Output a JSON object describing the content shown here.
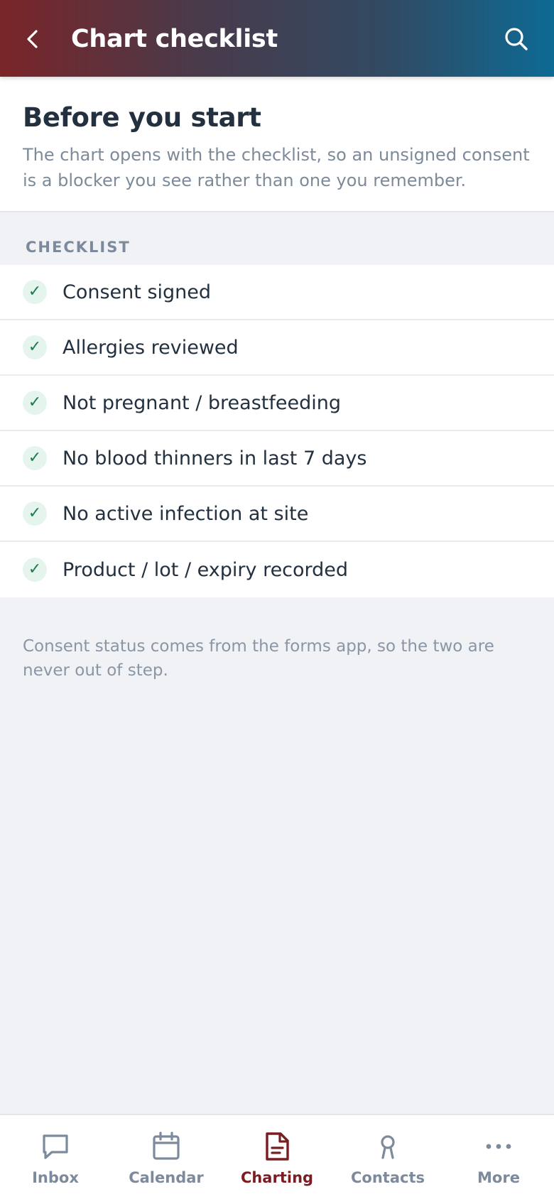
{
  "header": {
    "title": "Chart checklist",
    "back_icon": "chevron-left-icon",
    "search_icon": "search-icon"
  },
  "intro": {
    "heading": "Before you start",
    "description": "The chart opens with the checklist, so an unsigned consent is a blocker you see rather than one you remember."
  },
  "checklist": {
    "section_label": "CHECKLIST",
    "items": [
      {
        "label": "Consent signed",
        "checked": true
      },
      {
        "label": "Allergies reviewed",
        "checked": true
      },
      {
        "label": "Not pregnant / breastfeeding",
        "checked": true
      },
      {
        "label": "No blood thinners in last 7 days",
        "checked": true
      },
      {
        "label": "No active infection at site",
        "checked": true
      },
      {
        "label": "Product / lot / expiry recorded",
        "checked": true
      }
    ],
    "check_glyph": "✓"
  },
  "footnote": "Consent status comes from the forms app, so the two are never out of step.",
  "tab_bar": {
    "tabs": [
      {
        "label": "Inbox",
        "icon": "chat-bubble-icon",
        "active": false
      },
      {
        "label": "Calendar",
        "icon": "calendar-icon",
        "active": false
      },
      {
        "label": "Charting",
        "icon": "document-icon",
        "active": true
      },
      {
        "label": "Contacts",
        "icon": "person-icon",
        "active": false
      },
      {
        "label": "More",
        "icon": "more-dots-icon",
        "active": false
      }
    ]
  },
  "colors": {
    "accent": "#7a1d22",
    "check_green": "#1f7a4d",
    "inactive_tab": "#7d8a9c"
  }
}
